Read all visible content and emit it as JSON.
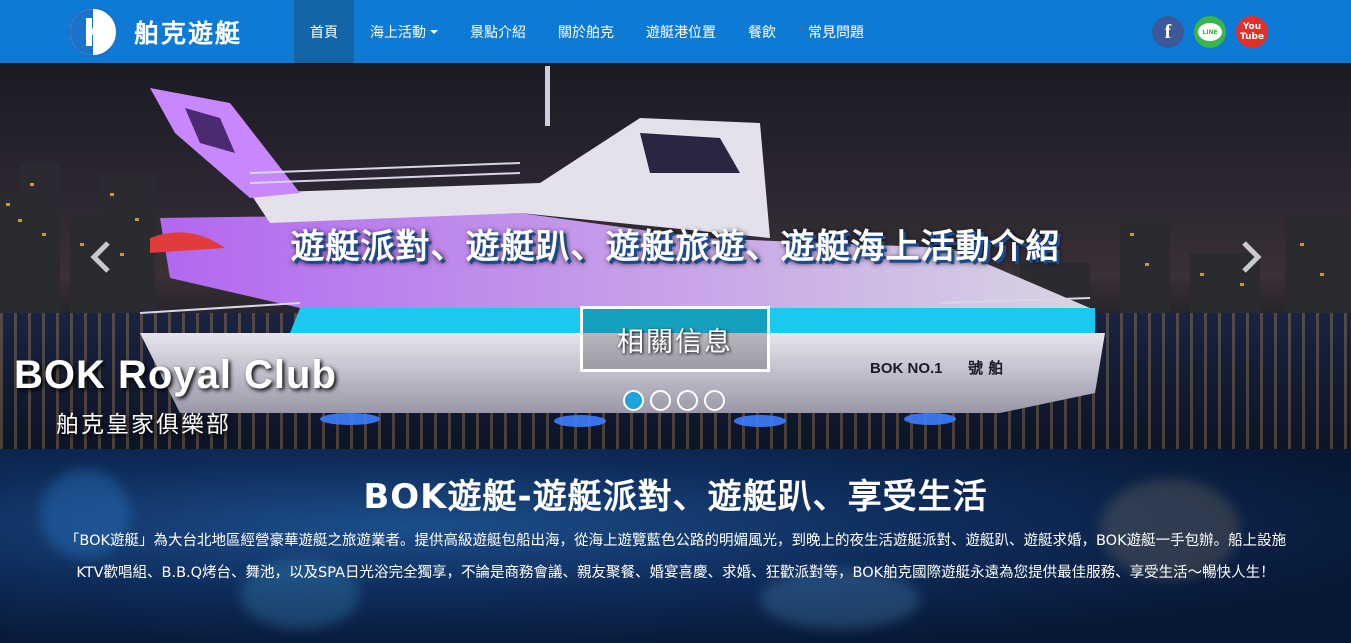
{
  "brand": {
    "name": "舶克遊艇",
    "logo_icon": "bok-logo-icon"
  },
  "nav": {
    "items": [
      {
        "label": "首頁",
        "active": true
      },
      {
        "label": "海上活動",
        "dropdown": true
      },
      {
        "label": "景點介紹"
      },
      {
        "label": "關於舶克"
      },
      {
        "label": "遊艇港位置"
      },
      {
        "label": "餐飲"
      },
      {
        "label": "常見問題"
      }
    ]
  },
  "social": {
    "facebook": "f",
    "line": "LINE",
    "youtube_top": "You",
    "youtube_bottom": "Tube"
  },
  "hero": {
    "title": "遊艇派對、遊艇趴、遊艇旅遊、遊艇海上活動介紹",
    "button_label": "相關信息",
    "club_name": "BOK Royal Club",
    "club_name_zh": "舶克皇家俱樂部",
    "boat_label_1": "BOK NO.1",
    "boat_label_2": "號 舶",
    "slides": 4,
    "active_slide": 1
  },
  "intro": {
    "title": "BOK遊艇-遊艇派對、遊艇趴、享受生活",
    "body": "「BOK遊艇」為大台北地區經營豪華遊艇之旅遊業者。提供高級遊艇包船出海，從海上遊覽藍色公路的明媚風光，到晚上的夜生活遊艇派對、遊艇趴、遊艇求婚，BOK遊艇一手包辦。船上設施KTV歡唱組、B.B.Q烤台、舞池，以及SPA日光浴完全獨享，不論是商務會議、親友聚餐、婚宴喜慶、求婚、狂歡派對等，BOK舶克國際遊艇永遠為您提供最佳服務、享受生活～暢快人生！"
  },
  "colors": {
    "navbar": "#0d7bd6",
    "nav_active": "#1465a8",
    "dot_active": "#1fa3e0"
  }
}
